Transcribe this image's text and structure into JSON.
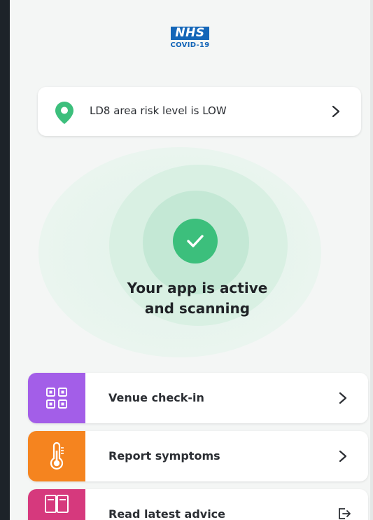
{
  "header": {
    "logo_text": "NHS",
    "logo_sub": "COVID-19"
  },
  "risk": {
    "label": "LD8 area risk level is LOW",
    "icon": "location-pin-icon"
  },
  "status": {
    "line1": "Your app is active",
    "line2": "and scanning",
    "icon": "check-icon"
  },
  "actions": [
    {
      "label": "Venue check-in",
      "icon": "qr-code-icon",
      "color": "#a35ee8",
      "trailing": "chevron-right-icon"
    },
    {
      "label": "Report symptoms",
      "icon": "thermometer-icon",
      "color": "#f5841f",
      "trailing": "chevron-right-icon"
    },
    {
      "label": "Read latest advice",
      "icon": "book-icon",
      "color": "#d6397d",
      "trailing": "external-link-icon"
    }
  ],
  "colors": {
    "nhs_blue": "#1466b8",
    "accent_green": "#3cbf7c",
    "venue_purple": "#a35ee8",
    "symptoms_orange": "#f5841f",
    "advice_pink": "#d6397d"
  }
}
